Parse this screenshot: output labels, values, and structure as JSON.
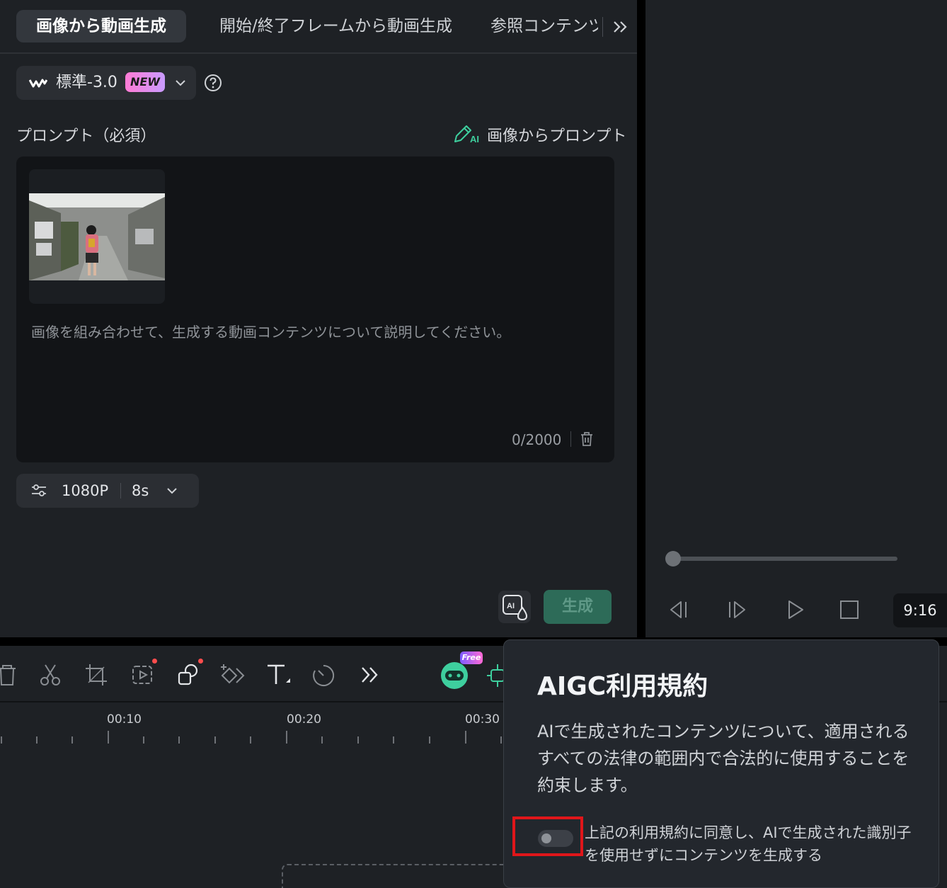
{
  "tabs": [
    {
      "label": "画像から動画生成"
    },
    {
      "label": "開始/終了フレームから動画生成"
    },
    {
      "label": "参照コンテンツが"
    }
  ],
  "model": {
    "name": "標準-3.0",
    "badge": "NEW"
  },
  "prompt": {
    "label": "プロンプト（必須）",
    "image_prompt_link": "画像からプロンプト",
    "placeholder": "画像を組み合わせて、生成する動画コンテンツについて説明してください。",
    "char_count": "0/2000"
  },
  "settings": {
    "resolution": "1080P",
    "duration": "8s"
  },
  "generate_button": "生成",
  "preview": {
    "aspect_ratio": "9:16"
  },
  "toolbar": {
    "free_badge": "Free"
  },
  "timeline": {
    "labels": [
      "00:10",
      "00:20",
      "00:30"
    ]
  },
  "popup": {
    "title": "AIGC利用規約",
    "body": "AIで生成されたコンテンツについて、適用されるすべての法律の範囲内で合法的に使用することを約束します。",
    "agree_text": "上記の利用規約に同意し、AIで生成された識別子を使用せずにコンテンツを生成する",
    "toggle_on": false
  },
  "colors": {
    "accent_green": "#2d6b58",
    "highlight_red": "#e0161a",
    "ai_icon_green": "#3ecf9e"
  }
}
